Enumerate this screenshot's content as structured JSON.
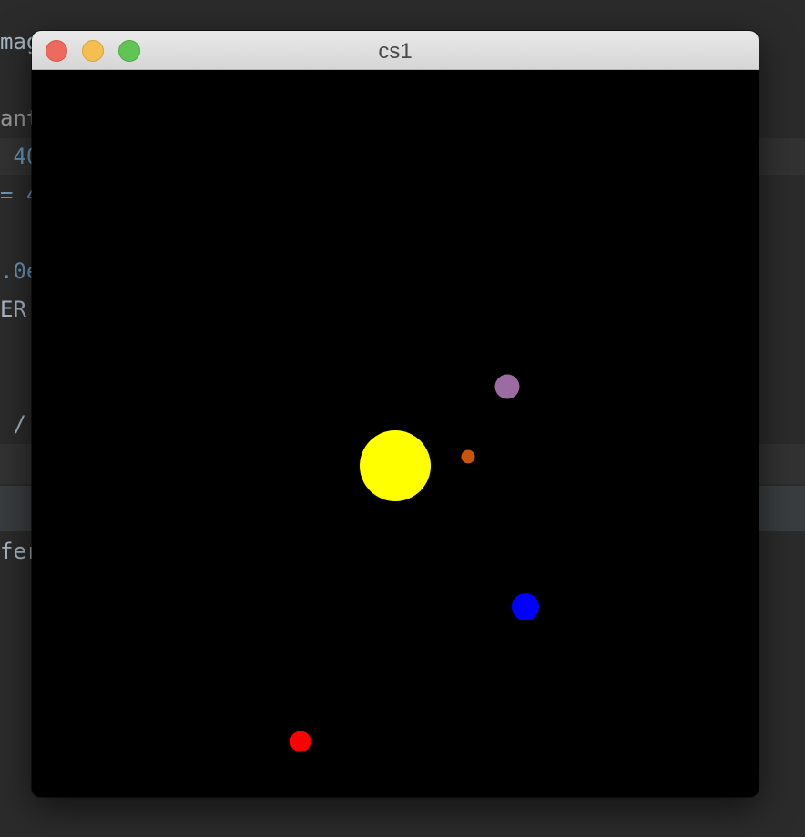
{
  "window": {
    "title": "cs1"
  },
  "editor_fragments": [
    "mag",
    "ant",
    " 40",
    "= 4",
    ".0e",
    "ER ",
    " /",
    "fer"
  ],
  "bodies": [
    {
      "name": "sun",
      "color": "#ffff00"
    },
    {
      "name": "purple-planet",
      "color": "#9b6ba1"
    },
    {
      "name": "orange-planet",
      "color": "#c8540a"
    },
    {
      "name": "blue-planet",
      "color": "#0000ff"
    },
    {
      "name": "red-planet",
      "color": "#ff0000"
    }
  ],
  "colors": {
    "canvas_background": "#000000",
    "editor_background": "#2b2b2b"
  }
}
